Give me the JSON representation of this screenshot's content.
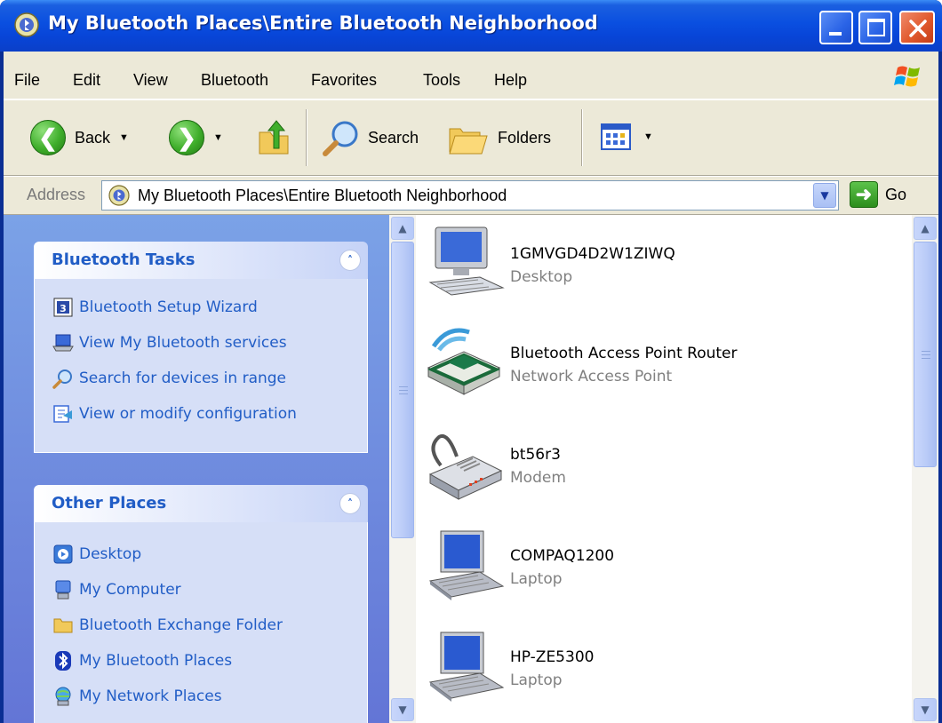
{
  "window": {
    "title": "My Bluetooth Places\\Entire Bluetooth Neighborhood"
  },
  "menu": {
    "items": [
      "File",
      "Edit",
      "View",
      "Bluetooth",
      "Favorites",
      "Tools",
      "Help"
    ]
  },
  "toolbar": {
    "back_label": "Back",
    "search_label": "Search",
    "folders_label": "Folders"
  },
  "address": {
    "label": "Address",
    "value": "My Bluetooth Places\\Entire Bluetooth Neighborhood",
    "go_label": "Go"
  },
  "taskpane": {
    "bluetooth_tasks": {
      "title": "Bluetooth Tasks",
      "items": [
        {
          "label": "Bluetooth Setup Wizard",
          "icon": "wizard-icon"
        },
        {
          "label": "View My Bluetooth services",
          "icon": "laptop-services-icon"
        },
        {
          "label": "Search for devices in range",
          "icon": "search-icon"
        },
        {
          "label": "View or modify configuration",
          "icon": "configuration-icon"
        }
      ]
    },
    "other_places": {
      "title": "Other Places",
      "items": [
        {
          "label": "Desktop",
          "icon": "desktop-icon"
        },
        {
          "label": "My Computer",
          "icon": "my-computer-icon"
        },
        {
          "label": "Bluetooth Exchange Folder",
          "icon": "folder-icon"
        },
        {
          "label": "My Bluetooth Places",
          "icon": "bluetooth-icon"
        },
        {
          "label": "My Network Places",
          "icon": "network-places-icon"
        }
      ]
    }
  },
  "devices": [
    {
      "name": "1GMVGD4D2W1ZIWQ",
      "type": "Desktop",
      "icon": "desktop-computer-icon"
    },
    {
      "name": "Bluetooth Access Point Router",
      "type": "Network Access Point",
      "icon": "access-point-icon"
    },
    {
      "name": "bt56r3",
      "type": "Modem",
      "icon": "modem-icon"
    },
    {
      "name": "COMPAQ1200",
      "type": "Laptop",
      "icon": "laptop-icon"
    },
    {
      "name": "HP-ZE5300",
      "type": "Laptop",
      "icon": "laptop-icon"
    }
  ],
  "colors": {
    "titlebar_blue": "#0a4fe0",
    "taskpane_blue": "#6375d6",
    "link_blue": "#215dc6",
    "chrome_beige": "#ece9d8"
  }
}
